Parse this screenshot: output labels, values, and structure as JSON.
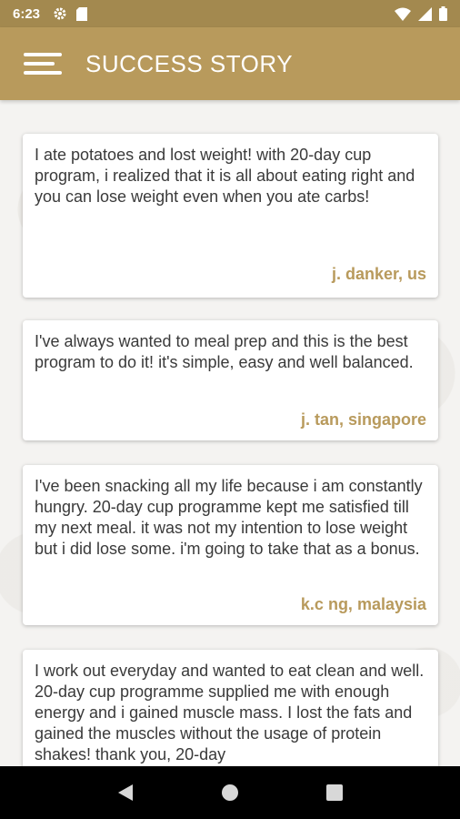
{
  "status_bar": {
    "time": "6:23",
    "icons_left": [
      "gear-icon",
      "sd-card-icon"
    ],
    "icons_right": [
      "wifi-icon",
      "signal-icon",
      "battery-icon"
    ]
  },
  "app_bar": {
    "title": "SUCCESS STORY",
    "menu_icon": "menu-icon",
    "color": "#b89a5c"
  },
  "stories": [
    {
      "text": "I ate potatoes and lost weight! with 20-day cup program, i realized that it is all about eating right and you can lose weight even when you ate carbs!",
      "author": "j. danker, us"
    },
    {
      "text": "I've always wanted to meal prep and this is the best program to do it! it's simple, easy and well balanced.",
      "author": "j. tan, singapore"
    },
    {
      "text": "I've been snacking all my life because i am constantly hungry. 20-day cup programme kept me satisfied till my next meal. it was not my intention to lose weight but i did lose some. i'm going to take that as a bonus.",
      "author": "k.c ng, malaysia"
    },
    {
      "text": "I work out everyday and wanted to eat clean and well. 20-day cup programme supplied me with enough energy and i gained muscle mass. I lost the fats and gained the muscles without the usage of protein shakes! thank you, 20-day",
      "author": ""
    }
  ],
  "nav_bar": {
    "buttons": [
      "back-icon",
      "home-icon",
      "recents-icon"
    ]
  }
}
